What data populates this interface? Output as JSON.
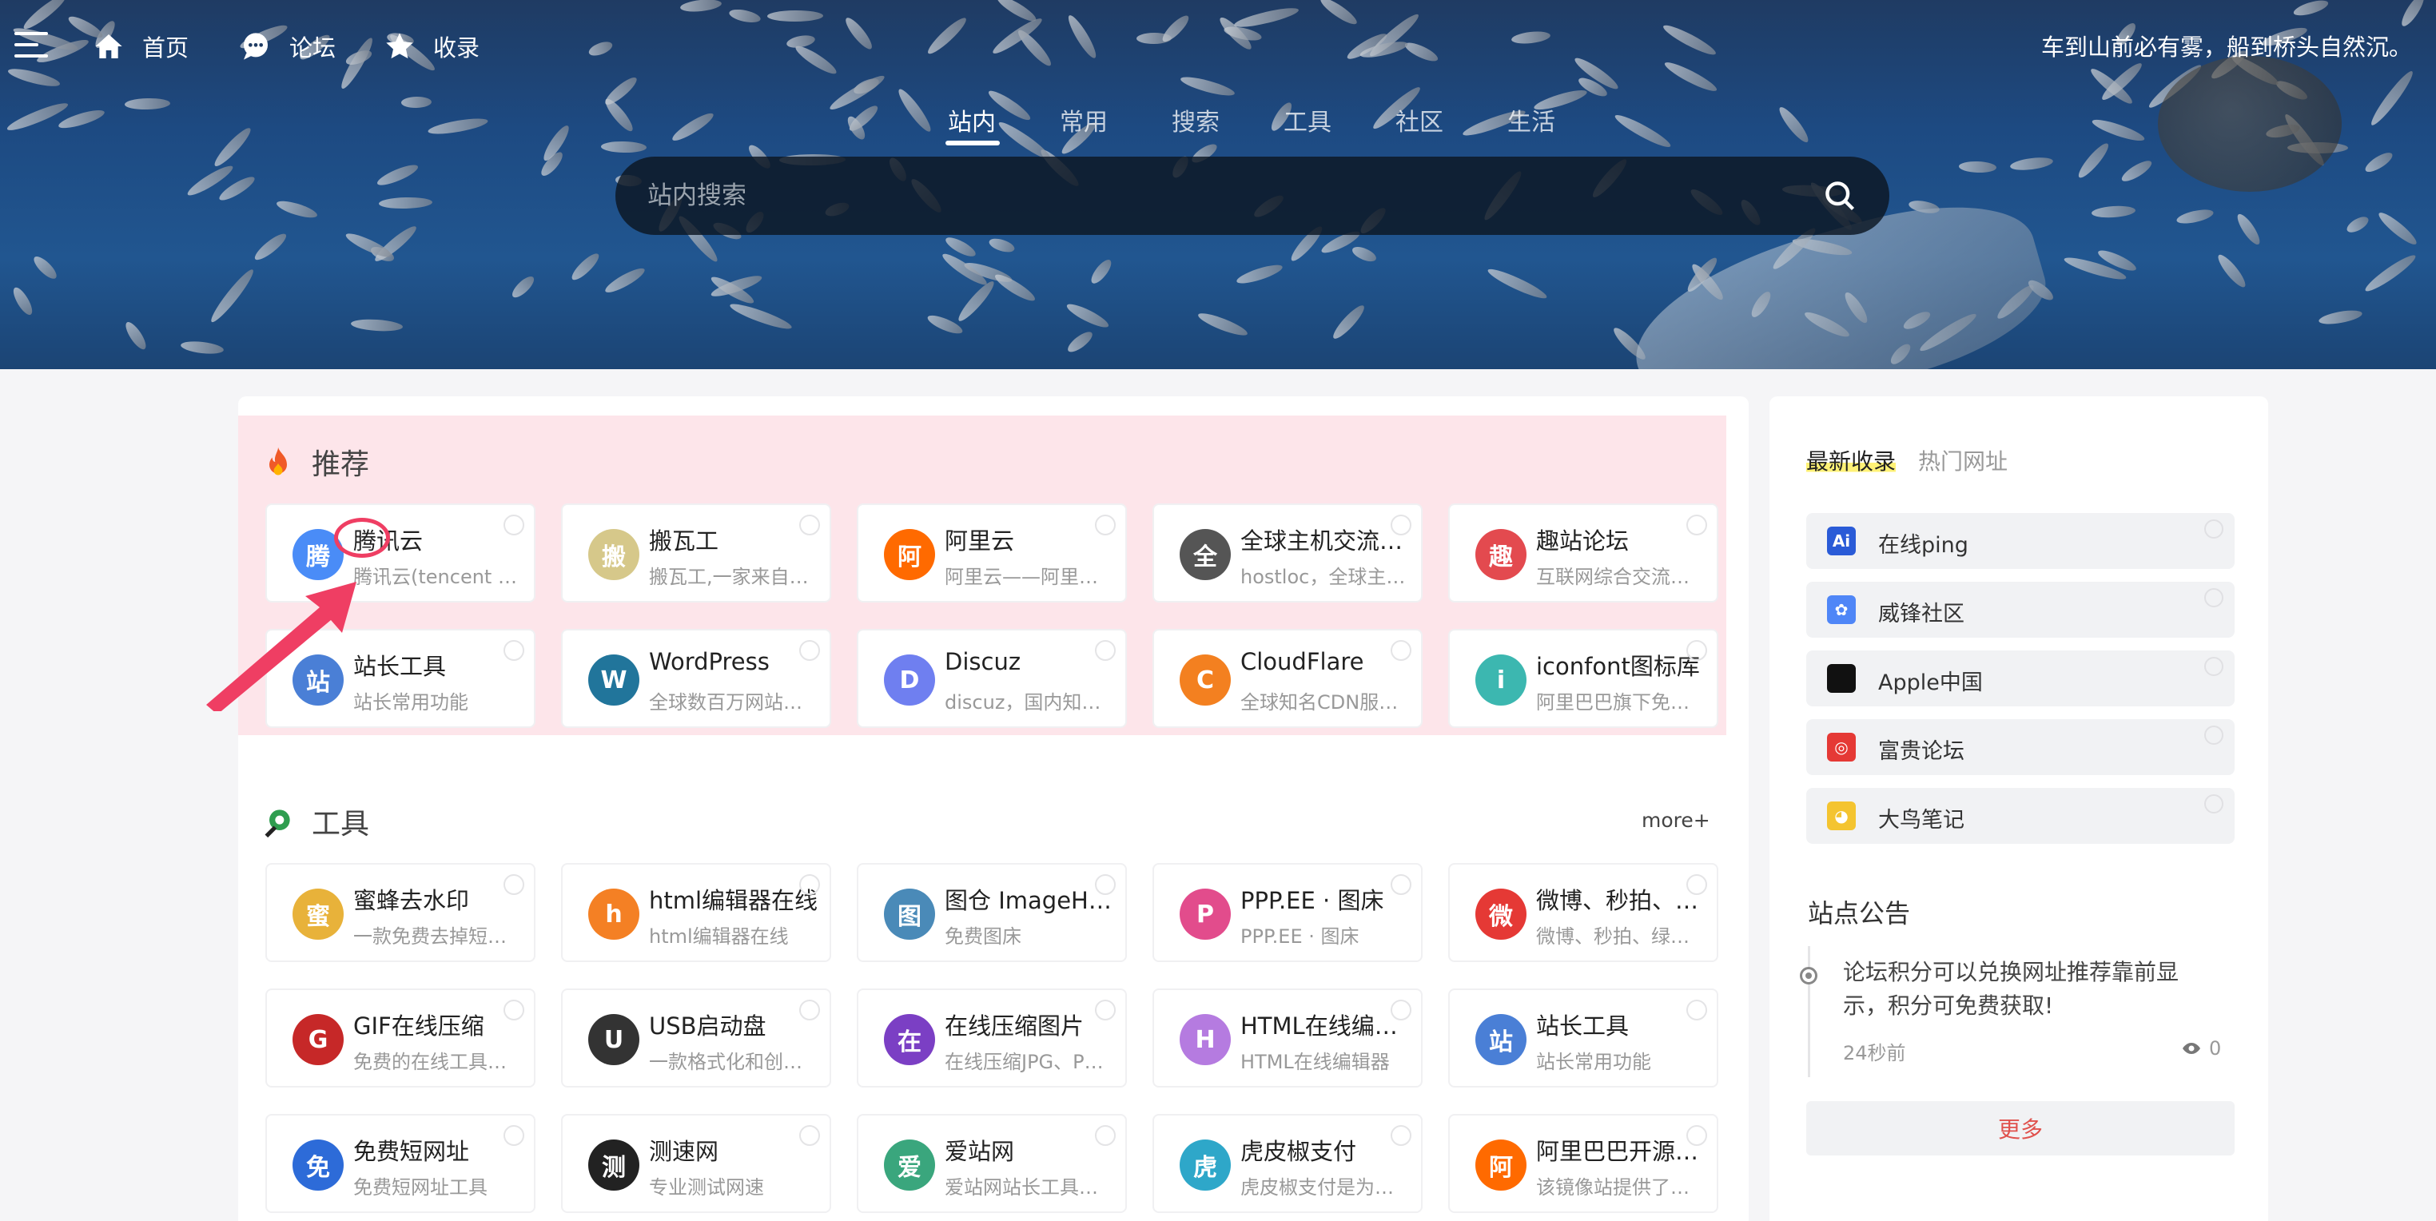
{
  "nav": {
    "home": "首页",
    "forum": "论坛",
    "favorites": "收录",
    "slogan": "车到山前必有雾，船到桥头自然沉。"
  },
  "tabs": [
    "站内",
    "常用",
    "搜索",
    "工具",
    "社区",
    "生活"
  ],
  "search": {
    "placeholder": "站内搜索"
  },
  "recommend": {
    "title": "推荐",
    "sites": [
      {
        "title": "腾讯云",
        "desc": "腾讯云(tencent cloud)",
        "icon": "tencent-cloud-icon",
        "color": "#4a8cf7"
      },
      {
        "title": "搬瓦工",
        "desc": "搬瓦工,一家来自美国的主机商",
        "icon": "bandwagon-icon",
        "color": "#d6c88a"
      },
      {
        "title": "阿里云",
        "desc": "阿里云——阿里巴巴集团旗下",
        "icon": "aliyun-icon",
        "color": "#ff6a00"
      },
      {
        "title": "全球主机交流论坛",
        "desc": "hostloc，全球主机交流论坛",
        "icon": "hostloc-icon",
        "color": "#555555"
      },
      {
        "title": "趣站论坛",
        "desc": "互联网综合交流论坛",
        "icon": "quzhan-icon",
        "color": "#e34a4f"
      },
      {
        "title": "站长工具",
        "desc": "站长常用功能",
        "icon": "webmaster-tools-icon",
        "color": "#4a7fd6"
      },
      {
        "title": "WordPress",
        "desc": "全球数百万网站使用的程序",
        "icon": "wordpress-icon",
        "color": "#21759b"
      },
      {
        "title": "Discuz",
        "desc": "discuz，国内知名论坛程序",
        "icon": "discuz-icon",
        "color": "#6f7ff0"
      },
      {
        "title": "CloudFlare",
        "desc": "全球知名CDN服务商",
        "icon": "cloudflare-icon",
        "color": "#f38020"
      },
      {
        "title": "iconfont图标库",
        "desc": "阿里巴巴旗下免费图标库",
        "icon": "iconfont-icon",
        "color": "#3cb7b0"
      }
    ]
  },
  "tools": {
    "title": "工具",
    "more": "more+",
    "sites": [
      {
        "title": "蜜蜂去水印",
        "desc": "一款免费去掉短视频水印工具",
        "icon": "bee-icon",
        "color": "#e8b23a"
      },
      {
        "title": "html编辑器在线",
        "desc": "html编辑器在线",
        "icon": "stackoverflow-icon",
        "color": "#f48024"
      },
      {
        "title": "图仓 ImageHost",
        "desc": "免费图床",
        "icon": "image-host-icon",
        "color": "#4a8ab8"
      },
      {
        "title": "PPP.EE · 图床",
        "desc": "PPP.EE · 图床",
        "icon": "pinwheel-icon",
        "color": "#e24c8c"
      },
      {
        "title": "微博、秒拍、绿洲视频下载",
        "desc": "微博、秒拍、绿洲视频下载",
        "icon": "download-icon",
        "color": "#e53935"
      },
      {
        "title": "GIF在线压缩",
        "desc": "免费的在线工具，压缩GIF",
        "icon": "gif-icon",
        "color": "#c62828"
      },
      {
        "title": "USB启动盘",
        "desc": "一款格式化和创建USB启动盘",
        "icon": "usb-icon",
        "color": "#333333"
      },
      {
        "title": "在线压缩图片",
        "desc": "在线压缩JPG、PNG图片",
        "icon": "flame-icon",
        "color": "#7b3fc4"
      },
      {
        "title": "HTML在线编辑器",
        "desc": "HTML在线编辑器",
        "icon": "h-letter-icon",
        "color": "#b57be0"
      },
      {
        "title": "站长工具",
        "desc": "站长常用功能",
        "icon": "webmaster-tools-icon",
        "color": "#4a7fd6"
      },
      {
        "title": "免费短网址",
        "desc": "免费短网址工具",
        "icon": "short-url-icon",
        "color": "#2d6bd8"
      },
      {
        "title": "测速网",
        "desc": "专业测试网速",
        "icon": "speedometer-icon",
        "color": "#222222"
      },
      {
        "title": "爱站网",
        "desc": "爱站网站长工具查询",
        "icon": "aizhan-icon",
        "color": "#3aa67d"
      },
      {
        "title": "虎皮椒支付",
        "desc": "虎皮椒支付是为个人开发者",
        "icon": "xunhupay-icon",
        "color": "#2ea7c9"
      },
      {
        "title": "阿里巴巴开源镜像站",
        "desc": "该镜像站提供了多种开源镜像",
        "icon": "aliyun-icon",
        "color": "#ff6a00"
      }
    ]
  },
  "sidebar": {
    "tab_latest": "最新收录",
    "tab_hot": "热门网址",
    "items": [
      {
        "label": "在线ping",
        "icon": "ping-icon",
        "color": "#2a5bd7",
        "glyph": "Ai"
      },
      {
        "label": "威锋社区",
        "icon": "feng-icon",
        "color": "#4f86f7",
        "glyph": "✿"
      },
      {
        "label": "Apple中国",
        "icon": "apple-icon",
        "color": "#111111",
        "glyph": ""
      },
      {
        "label": "富贵论坛",
        "icon": "fugui-icon",
        "color": "#e53935",
        "glyph": "◎"
      },
      {
        "label": "大鸟笔记",
        "icon": "bird-icon",
        "color": "#f4c430",
        "glyph": "◕"
      }
    ],
    "notice_title": "站点公告",
    "notice_text": "论坛积分可以兑换网址推荐靠前显示，积分可免费获取!",
    "notice_time": "24秒前",
    "notice_views": "0",
    "more": "更多"
  }
}
